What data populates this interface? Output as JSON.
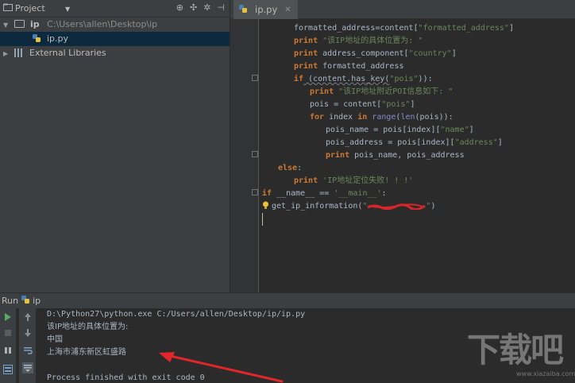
{
  "project_panel": {
    "title": "Project",
    "tree": [
      {
        "label": "ip",
        "path": "C:\\Users\\allen\\Desktop\\ip"
      },
      {
        "label": "ip.py"
      },
      {
        "label": "External Libraries"
      }
    ]
  },
  "editor": {
    "tab_label": "ip.py",
    "lines": [
      {
        "parts": [
          [
            "",
            "formatted_address=content["
          ],
          [
            "str",
            "\"formatted_address\""
          ],
          [
            "",
            "]"
          ]
        ]
      },
      {
        "parts": [
          [
            "kw",
            "print"
          ],
          [
            "",
            " "
          ],
          [
            "str",
            "\"该IP地址的具体位置为: \""
          ]
        ]
      },
      {
        "parts": [
          [
            "kw",
            "print"
          ],
          [
            "",
            " address_component["
          ],
          [
            "str",
            "\"country\""
          ],
          [
            "",
            "]"
          ]
        ]
      },
      {
        "parts": [
          [
            "kw",
            "print"
          ],
          [
            "",
            " formatted_address"
          ]
        ]
      },
      {
        "parts": [
          [
            "kw",
            "if"
          ],
          [
            "",
            " (content.has_key("
          ],
          [
            "str",
            "\"pois\""
          ],
          [
            "",
            ")):"
          ]
        ]
      },
      {
        "parts": [
          [
            "kw",
            "print"
          ],
          [
            "",
            " "
          ],
          [
            "str",
            "\"该IP地址附近POI信息如下: \""
          ]
        ]
      },
      {
        "parts": [
          [
            "",
            "pois = content["
          ],
          [
            "str",
            "\"pois\""
          ],
          [
            "",
            "]"
          ]
        ]
      },
      {
        "parts": [
          [
            "kw",
            "for"
          ],
          [
            "",
            " index "
          ],
          [
            "kw",
            "in"
          ],
          [
            "",
            " "
          ],
          [
            "bi",
            "range"
          ],
          [
            "",
            "("
          ],
          [
            "bi",
            "len"
          ],
          [
            "",
            "(pois)):"
          ]
        ]
      },
      {
        "parts": [
          [
            "",
            "pois_name = pois[index]["
          ],
          [
            "str",
            "\"name\""
          ],
          [
            "",
            "]"
          ]
        ]
      },
      {
        "parts": [
          [
            "",
            "pois_address = pois[index]["
          ],
          [
            "str",
            "\"address\""
          ],
          [
            "",
            "]"
          ]
        ]
      },
      {
        "parts": [
          [
            "kw",
            "print"
          ],
          [
            "",
            " pois_name, pois_address"
          ]
        ]
      },
      {
        "parts": [
          [
            "kw",
            "else"
          ],
          [
            "",
            ":"
          ]
        ]
      },
      {
        "parts": [
          [
            "kw",
            "print"
          ],
          [
            "",
            " "
          ],
          [
            "str",
            "'IP地址定位失败! ! !'"
          ]
        ]
      },
      {
        "parts": [
          [
            "kw",
            "if"
          ],
          [
            "",
            " __name__ == "
          ],
          [
            "str",
            "'__main__'"
          ],
          [
            "",
            ":"
          ]
        ]
      },
      {
        "parts": [
          [
            "",
            "get_ip_information("
          ],
          [
            "str",
            "\""
          ],
          [
            "redact",
            ""
          ],
          [
            "str",
            "\""
          ],
          [
            "",
            ")"
          ]
        ]
      }
    ]
  },
  "run_panel": {
    "title": "Run",
    "config": "ip",
    "console": [
      "D:\\Python27\\python.exe C:/Users/allen/Desktop/ip/ip.py",
      "该IP地址的具体位置为:",
      "中国",
      "上海市浦东新区虹盛路",
      "",
      "Process finished with exit code 0"
    ]
  },
  "watermark": {
    "logo": "下载吧",
    "url": "www.xiazaiba.com"
  },
  "colors": {
    "keyword": "#cc7832",
    "string": "#6a8759",
    "builtin": "#8888c6",
    "text": "#a9b7c6",
    "selection": "#0d293e",
    "arrow": "#e2262a"
  }
}
